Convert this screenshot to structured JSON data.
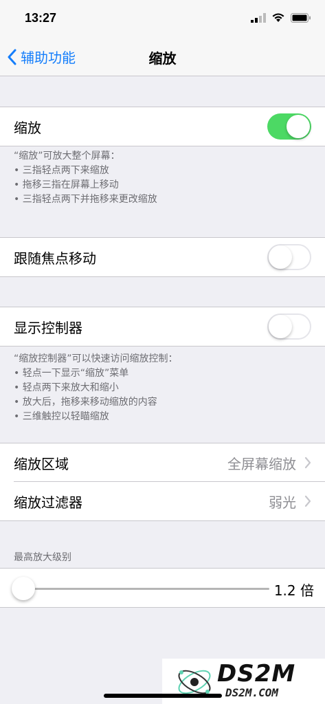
{
  "status_bar": {
    "time": "13:27"
  },
  "nav": {
    "back_label": "辅助功能",
    "title": "缩放"
  },
  "zoom_row": {
    "label": "缩放",
    "enabled": true
  },
  "zoom_footnote": {
    "title": "“缩放”可放大整个屏幕：",
    "items": [
      "三指轻点两下来缩放",
      "拖移三指在屏幕上移动",
      "三指轻点两下并拖移来更改缩放"
    ]
  },
  "follow_focus_row": {
    "label": "跟随焦点移动",
    "enabled": false
  },
  "controller_row": {
    "label": "显示控制器",
    "enabled": false
  },
  "controller_footnote": {
    "title": "“缩放控制器”可以快速访问缩放控制：",
    "items": [
      "轻点一下显示“缩放”菜单",
      "轻点两下来放大和缩小",
      "放大后，拖移来移动缩放的内容",
      "三维触控以轻瞄缩放"
    ]
  },
  "zoom_region_row": {
    "label": "缩放区域",
    "value": "全屏幕缩放"
  },
  "zoom_filter_row": {
    "label": "缩放过滤器",
    "value": "弱光"
  },
  "max_zoom": {
    "header": "最高放大级别",
    "value_label": "1.2 倍",
    "level": 0.0
  },
  "watermark": {
    "big": "DS2M",
    "small": "DS2M.COM"
  },
  "colors": {
    "accent": "#157efb",
    "toggle_on": "#4cd964",
    "background": "#efeff4"
  }
}
